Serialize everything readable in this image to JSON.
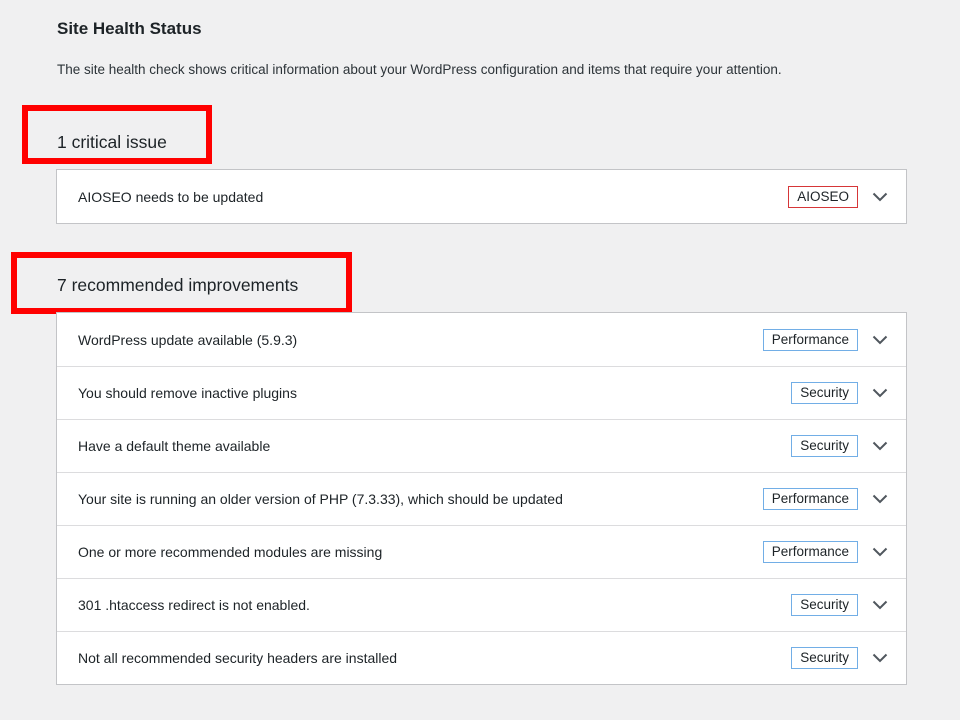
{
  "header": {
    "title": "Site Health Status",
    "description": "The site health check shows critical information about your WordPress configuration and items that require your attention."
  },
  "critical": {
    "heading": "1 critical issue",
    "items": [
      {
        "label": "AIOSEO needs to be updated",
        "badge": "AIOSEO",
        "badge_color": "#d63638",
        "icon": "chevron-down-icon"
      }
    ]
  },
  "recommended": {
    "heading": "7 recommended improvements",
    "items": [
      {
        "label": "WordPress update available (5.9.3)",
        "badge": "Performance",
        "badge_color": "#72aee6",
        "icon": "chevron-down-icon"
      },
      {
        "label": "You should remove inactive plugins",
        "badge": "Security",
        "badge_color": "#72aee6",
        "icon": "chevron-down-icon"
      },
      {
        "label": "Have a default theme available",
        "badge": "Security",
        "badge_color": "#72aee6",
        "icon": "chevron-down-icon"
      },
      {
        "label": "Your site is running an older version of PHP (7.3.33), which should be updated",
        "badge": "Performance",
        "badge_color": "#72aee6",
        "icon": "chevron-down-icon"
      },
      {
        "label": "One or more recommended modules are missing",
        "badge": "Performance",
        "badge_color": "#72aee6",
        "icon": "chevron-down-icon"
      },
      {
        "label": "301 .htaccess redirect is not enabled.",
        "badge": "Security",
        "badge_color": "#72aee6",
        "icon": "chevron-down-icon"
      },
      {
        "label": "Not all recommended security headers are installed",
        "badge": "Security",
        "badge_color": "#72aee6",
        "icon": "chevron-down-icon"
      }
    ]
  },
  "annotation_color": "#ff0000"
}
